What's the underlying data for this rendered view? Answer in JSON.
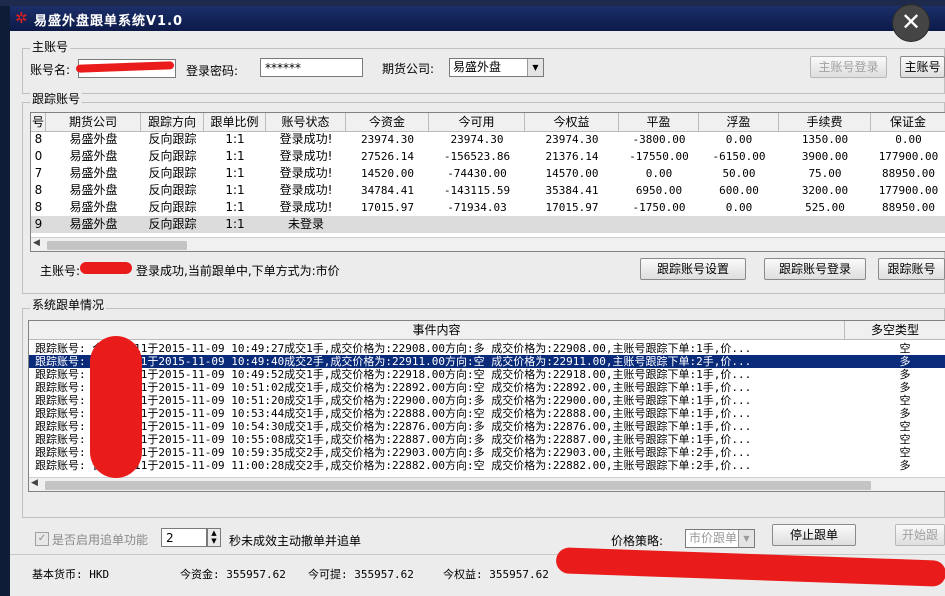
{
  "window": {
    "title": "易盛外盘跟单系统V1.0",
    "close_glyph": "✕"
  },
  "main_account": {
    "group_label": "主账号",
    "account_label": "账号名:",
    "password_label": "登录密码:",
    "password_value": "******",
    "company_label": "期货公司:",
    "company_value": "易盛外盘",
    "login_button": "主账号登录",
    "other_button": "主账号"
  },
  "follow_accounts": {
    "group_label": "跟踪账号",
    "columns": [
      "号",
      "期货公司",
      "跟踪方向",
      "跟单比例",
      "账号状态",
      "今资金",
      "今可用",
      "今权益",
      "平盈",
      "浮盈",
      "手续费",
      "保证金"
    ],
    "rows": [
      [
        "8",
        "易盛外盘",
        "反向跟踪",
        "1:1",
        "登录成功!",
        "23974.30",
        "23974.30",
        "23974.30",
        "-3800.00",
        "0.00",
        "1350.00",
        "0.00"
      ],
      [
        "0",
        "易盛外盘",
        "反向跟踪",
        "1:1",
        "登录成功!",
        "27526.14",
        "-156523.86",
        "21376.14",
        "-17550.00",
        "-6150.00",
        "3900.00",
        "177900.00"
      ],
      [
        "7",
        "易盛外盘",
        "反向跟踪",
        "1:1",
        "登录成功!",
        "14520.00",
        "-74430.00",
        "14570.00",
        "0.00",
        "50.00",
        "75.00",
        "88950.00"
      ],
      [
        "8",
        "易盛外盘",
        "反向跟踪",
        "1:1",
        "登录成功!",
        "34784.41",
        "-143115.59",
        "35384.41",
        "6950.00",
        "600.00",
        "3200.00",
        "177900.00"
      ],
      [
        "8",
        "易盛外盘",
        "反向跟踪",
        "1:1",
        "登录成功!",
        "17015.97",
        "-71934.03",
        "17015.97",
        "-1750.00",
        "0.00",
        "525.00",
        "88950.00"
      ],
      [
        "9",
        "易盛外盘",
        "反向跟踪",
        "1:1",
        "未登录",
        "",
        "",
        "",
        "",
        "",
        "",
        ""
      ]
    ],
    "status_prefix": "主账号:",
    "status_text": "登录成功,当前跟单中,下单方式为:市价",
    "buttons": [
      "跟踪账号设置",
      "跟踪账号登录",
      "跟踪账号"
    ]
  },
  "system_log": {
    "group_label": "系统跟单情况",
    "columns": [
      "事件内容",
      "多空类型"
    ],
    "rows": [
      {
        "text": "跟踪账号:        合约:1511于2015-11-09 10:49:27成交1手,成交价格为:22908.00方向:多 成交价格为:22908.00,主账号跟踪下单:1手,价...",
        "type": "空"
      },
      {
        "text": "跟踪账号:        合约:1511于2015-11-09 10:49:40成交2手,成交价格为:22911.00方向:空 成交价格为:22911.00,主账号跟踪下单:2手,价...",
        "type": "多"
      },
      {
        "text": "跟踪账号:        合约:1511于2015-11-09 10:49:52成交1手,成交价格为:22918.00方向:空 成交价格为:22918.00,主账号跟踪下单:1手,价...",
        "type": "多"
      },
      {
        "text": "跟踪账号:        合约:1511于2015-11-09 10:51:02成交1手,成交价格为:22892.00方向:空 成交价格为:22892.00,主账号跟踪下单:1手,价...",
        "type": "多"
      },
      {
        "text": "跟踪账号:        合约:1511于2015-11-09 10:51:20成交1手,成交价格为:22900.00方向:多 成交价格为:22900.00,主账号跟踪下单:1手,价...",
        "type": "空"
      },
      {
        "text": "跟踪账号:        合约:1511于2015-11-09 10:53:44成交1手,成交价格为:22888.00方向:空 成交价格为:22888.00,主账号跟踪下单:1手,价...",
        "type": "多"
      },
      {
        "text": "跟踪账号:        合约:1511于2015-11-09 10:54:30成交1手,成交价格为:22876.00方向:多 成交价格为:22876.00,主账号跟踪下单:1手,价...",
        "type": "空"
      },
      {
        "text": "跟踪账号:        合约:1511于2015-11-09 10:55:08成交1手,成交价格为:22887.00方向:多 成交价格为:22887.00,主账号跟踪下单:1手,价...",
        "type": "空"
      },
      {
        "text": "跟踪账号:        合约:1511于2015-11-09 10:59:35成交2手,成交价格为:22903.00方向:多 成交价格为:22903.00,主账号跟踪下单:2手,价...",
        "type": "空"
      },
      {
        "text": "跟踪账号:        合约:1511于2015-11-09 11:00:28成交2手,成交价格为:22882.00方向:空 成交价格为:22882.00,主账号跟踪下单:2手,价...",
        "type": "多"
      }
    ]
  },
  "bottom": {
    "chase_label": "是否启用追单功能",
    "chase_seconds": "2",
    "chase_suffix": "秒未成效主动撤单并追单",
    "price_strategy_label": "价格策略:",
    "price_strategy_value": "市价跟单",
    "stop_button": "停止跟单",
    "start_button": "开始跟"
  },
  "status": {
    "currency": "基本货币: HKD",
    "funds": "今资金:   355957.62",
    "available": "今可提:   355957.62",
    "equity": "今权益:   355957.62"
  },
  "colors": {
    "title_bg": "#0c1a48",
    "selection": "#0a2a7a",
    "redaction": "#ea1b1b"
  }
}
